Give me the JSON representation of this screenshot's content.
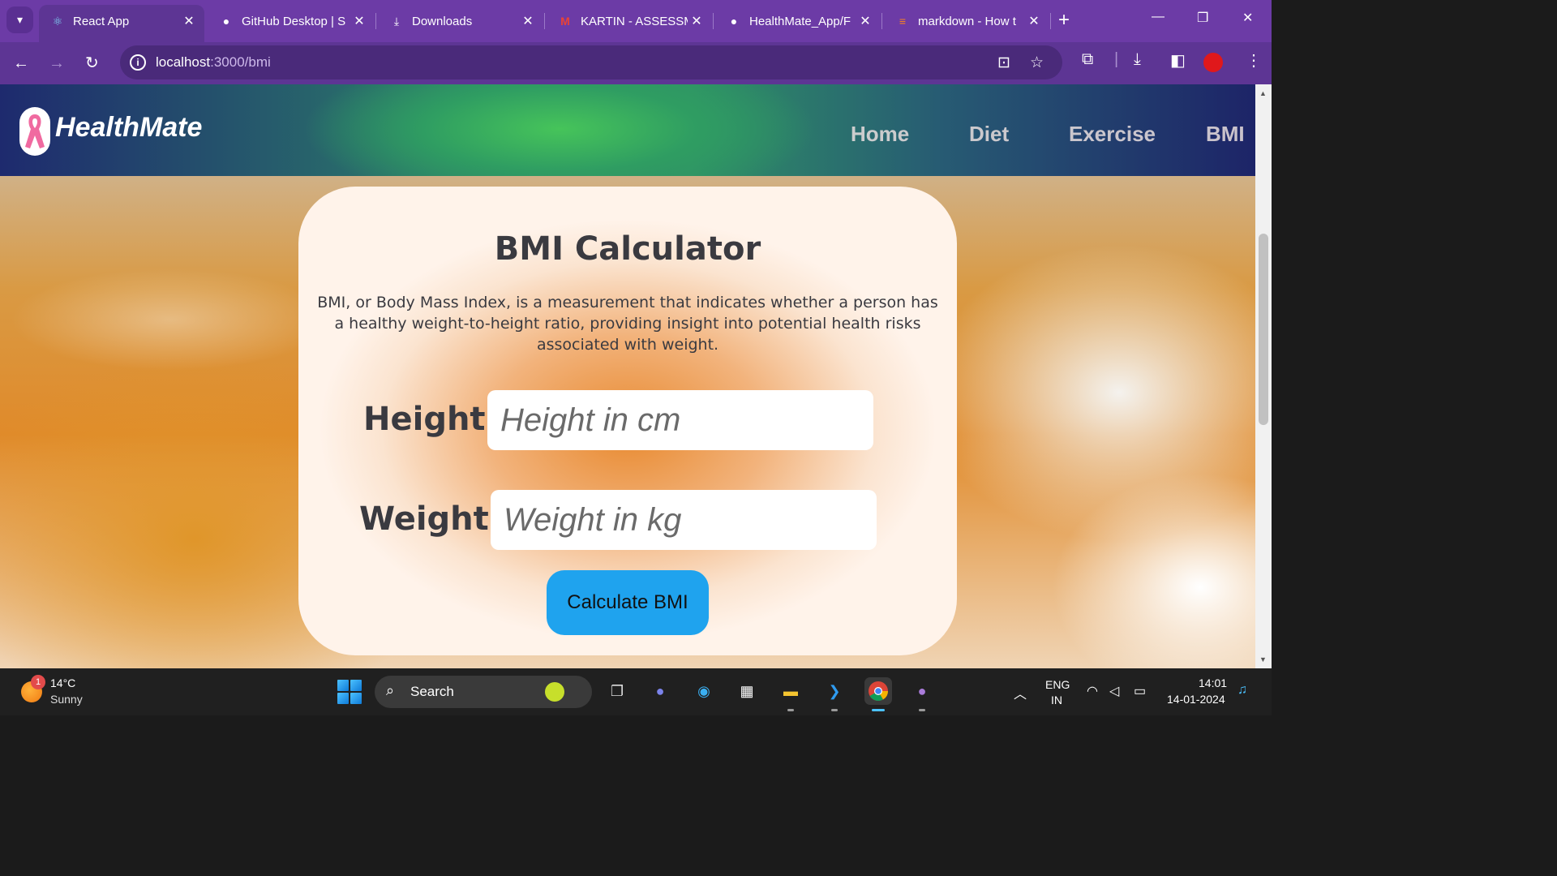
{
  "browser": {
    "tabs": [
      {
        "title": "React App",
        "icon": "react-icon",
        "active": true
      },
      {
        "title": "GitHub Desktop | S",
        "icon": "github-icon",
        "active": false
      },
      {
        "title": "Downloads",
        "icon": "download-icon",
        "active": false
      },
      {
        "title": "KARTIN - ASSESSM",
        "icon": "gmail-icon",
        "active": false
      },
      {
        "title": "HealthMate_App/F",
        "icon": "github-icon",
        "active": false
      },
      {
        "title": "markdown - How t",
        "icon": "stackoverflow-icon",
        "active": false
      }
    ],
    "address": {
      "host": "localhost",
      "path": ":3000/bmi"
    },
    "accent_color": "#6c3ba6"
  },
  "app": {
    "brand": "HealthMate",
    "nav": [
      "Home",
      "Diet",
      "Exercise",
      "BMI"
    ],
    "card": {
      "title": "BMI Calculator",
      "description": "BMI, or Body Mass Index, is a measurement that indicates whether a person has a healthy weight-to-height ratio, providing insight into potential health risks associated with weight.",
      "height_label": "Height:",
      "height_placeholder": "Height in cm",
      "weight_label": "Weight:",
      "weight_placeholder": "Weight in kg",
      "button_label": "Calculate BMI",
      "button_color": "#1fa3ee"
    }
  },
  "taskbar": {
    "weather": {
      "temp": "14°C",
      "condition": "Sunny",
      "badge": "1"
    },
    "search_label": "Search",
    "lang_line1": "ENG",
    "lang_line2": "IN",
    "time": "14:01",
    "date": "14-01-2024"
  }
}
